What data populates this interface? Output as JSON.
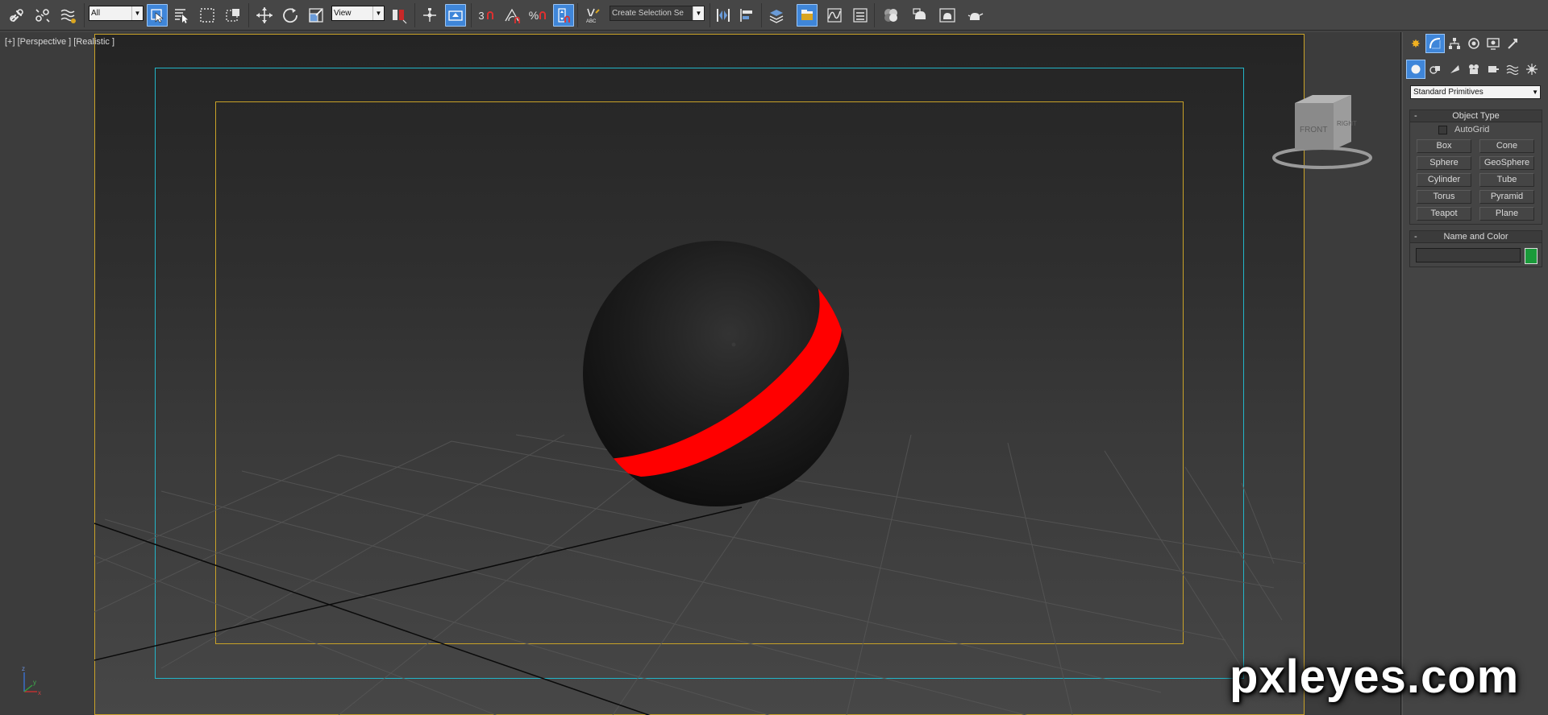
{
  "toolbar": {
    "selection_filter": "All",
    "reference_coord": "View",
    "named_selection": "Create Selection Se",
    "snap_number": "3",
    "percent_snap": "%"
  },
  "viewport": {
    "label": "[+] [Perspective ] [Realistic ]",
    "viewcube_front": "FRONT",
    "viewcube_right": "RIGHT",
    "axis_z": "z",
    "axis_x": "x",
    "axis_y": "y",
    "sphere_color": "#1a1a1a",
    "stripe_color": "#ff0000",
    "safe_frame_color": "#22b5c8",
    "render_frame_color": "#c9a228"
  },
  "command_panel": {
    "category": "Standard Primitives",
    "object_type": {
      "title": "Object Type",
      "autogrid_label": "AutoGrid",
      "buttons": [
        "Box",
        "Cone",
        "Sphere",
        "GeoSphere",
        "Cylinder",
        "Tube",
        "Torus",
        "Pyramid",
        "Teapot",
        "Plane"
      ]
    },
    "name_and_color": {
      "title": "Name and Color",
      "name_value": "",
      "color": "#1a9a3a"
    }
  },
  "watermark": "pxleyes.com"
}
